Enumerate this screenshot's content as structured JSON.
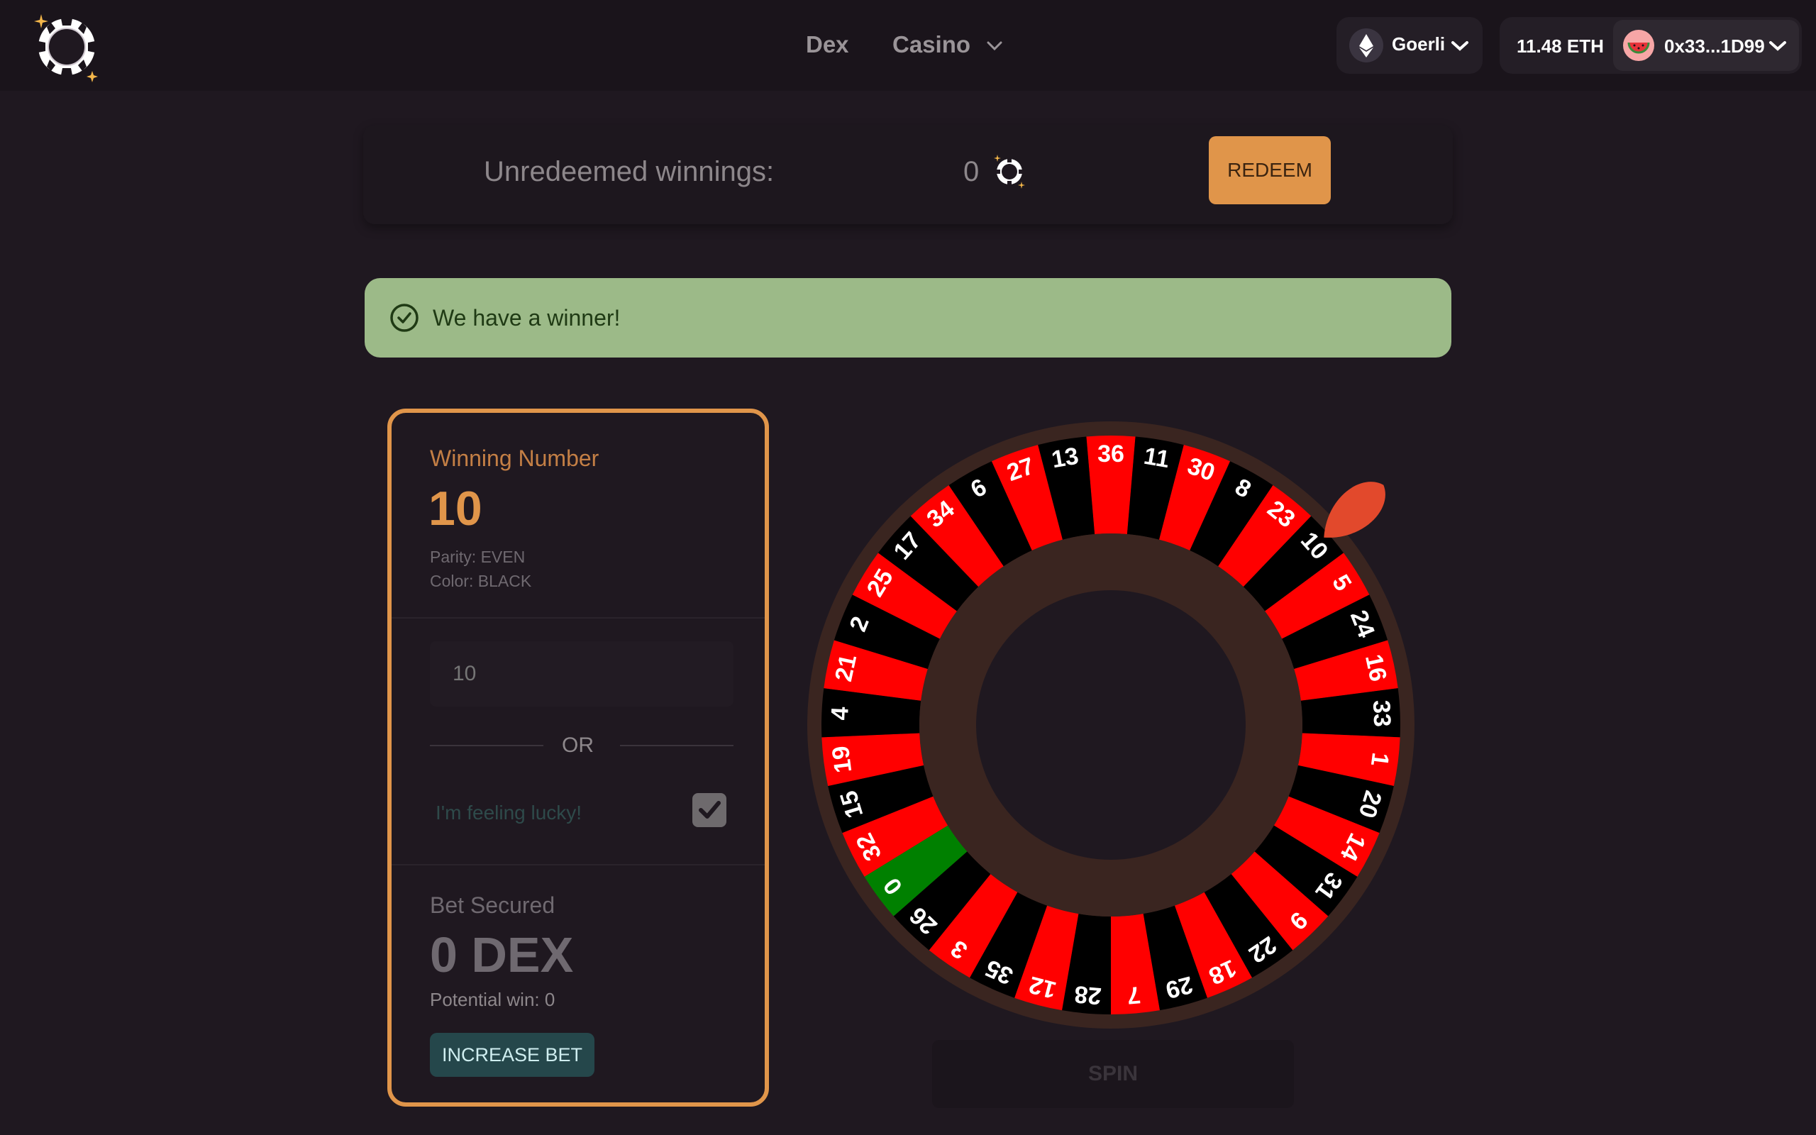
{
  "nav": {
    "links": [
      "Dex",
      "Casino"
    ],
    "network": "Goerli",
    "balance": "11.48 ETH",
    "address": "0x33...1D99"
  },
  "winnings": {
    "label": "Unredeemed winnings:",
    "value": "0",
    "redeem_label": "REDEEM"
  },
  "alert": {
    "message": "We have a winner!"
  },
  "bet": {
    "winning_label": "Winning Number",
    "winning_number": "10",
    "parity": "Parity: EVEN",
    "color": "Color: BLACK",
    "number_input_placeholder": "10",
    "or_label": "OR",
    "lucky_label": "I'm feeling lucky!",
    "lucky_checked": true,
    "secured_label": "Bet Secured",
    "secured_value": "0 DEX",
    "potential_win": "Potential win: 0",
    "increase_label": "INCREASE BET"
  },
  "wheel": {
    "numbers": [
      "36",
      "11",
      "30",
      "8",
      "23",
      "10",
      "5",
      "24",
      "16",
      "33",
      "1",
      "20",
      "14",
      "31",
      "9",
      "22",
      "18",
      "29",
      "7",
      "28",
      "12",
      "35",
      "3",
      "26",
      "0",
      "32",
      "15",
      "19",
      "4",
      "21",
      "2",
      "25",
      "17",
      "34",
      "6",
      "27",
      "13"
    ],
    "colors": {
      "red": "#ff0000",
      "black": "#000000",
      "green": "#008000",
      "rim": "#3a2520",
      "hub": "#3a2520",
      "center": "#1f1820",
      "pointer": "#e2492c"
    },
    "pointer_on": "10"
  },
  "spin": {
    "label": "SPIN"
  },
  "theme": {
    "accent": "#e0954a",
    "alert_bg": "#9cba88",
    "background": "#1f1820"
  }
}
